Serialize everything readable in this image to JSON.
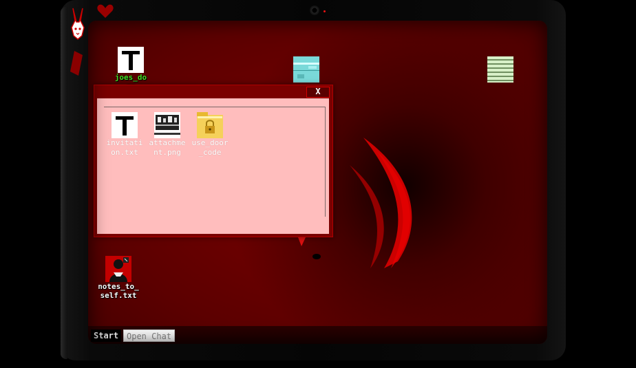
{
  "desktop": {
    "icons": [
      {
        "label": "joes_dogg",
        "icon": "text-file-icon"
      },
      {
        "label": "",
        "icon": "image-file-icon"
      },
      {
        "label": "",
        "icon": "document-stack-icon"
      },
      {
        "label": "notes_to_self.txt",
        "icon": "photo-file-icon"
      }
    ]
  },
  "window": {
    "close_label": "X",
    "files": [
      {
        "label": "invitation.txt",
        "icon": "text-file-icon"
      },
      {
        "label": "attachment.png",
        "icon": "image-file-icon"
      },
      {
        "label": "use_door_code",
        "icon": "locked-folder-icon"
      }
    ]
  },
  "taskbar": {
    "start_label": "Start",
    "open_chat_label": "Open Chat"
  },
  "colors": {
    "screen_red": "#7a0000",
    "window_body": "#ffbdbd",
    "accent": "#d40000",
    "desktop_label_green": "#44dd22"
  }
}
